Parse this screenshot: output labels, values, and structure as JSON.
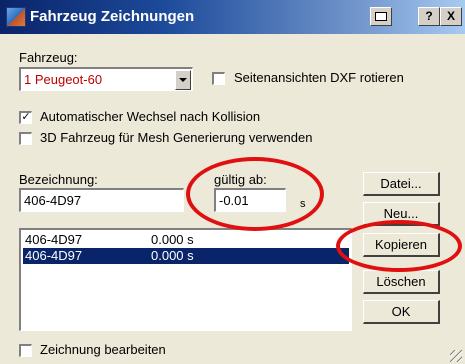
{
  "window": {
    "title": "Fahrzeug Zeichnungen"
  },
  "titlebar": {
    "help_label": "?",
    "close_label": "X"
  },
  "vehicle": {
    "label": "Fahrzeug:",
    "selected": "1  Peugeot-60",
    "selected_color": "#C00000"
  },
  "checkboxes": {
    "rotate_dxf": {
      "label": "Seitenansichten DXF rotieren",
      "checked": false
    },
    "auto_switch": {
      "label": "Automatischer Wechsel nach Kollision",
      "checked": true
    },
    "mesh_3d": {
      "label": "3D Fahrzeug für Mesh Generierung verwenden",
      "checked": false
    },
    "edit_drawing": {
      "label": "Zeichnung bearbeiten",
      "checked": false
    }
  },
  "designation": {
    "label": "Bezeichnung:",
    "value": "406-4D97"
  },
  "valid_from": {
    "label": "gültig ab:",
    "value": "-0.01",
    "unit": "s"
  },
  "list": {
    "rows": [
      {
        "name": "406-4D97",
        "time": "0.000 s",
        "selected": false
      },
      {
        "name": "406-4D97",
        "time": "0.000 s",
        "selected": true
      }
    ]
  },
  "buttons": {
    "file": "Datei...",
    "new": "Neu...",
    "copy": "Kopieren",
    "delete": "Löschen",
    "ok": "OK"
  },
  "annotations": {
    "circle_color": "#E01010"
  },
  "colors": {
    "title_start": "#0A246A",
    "title_end": "#A6CAF0",
    "selection": "#0A246A",
    "dialog_bg": "#ECE9D8"
  }
}
